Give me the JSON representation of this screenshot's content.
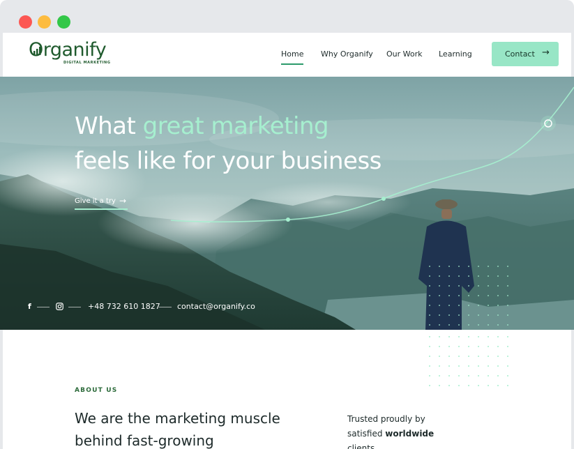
{
  "brand": {
    "name": "Organify",
    "tagline": "DIGITAL MARKETING",
    "color": "#1f5a2d"
  },
  "nav": {
    "items": [
      {
        "label": "Home",
        "active": true
      },
      {
        "label": "Why Organify",
        "active": false
      },
      {
        "label": "Our Work",
        "active": false
      },
      {
        "label": "Learning",
        "active": false
      }
    ],
    "contact_label": "Contact",
    "contact_icon": "arrow-right-icon",
    "contact_color": "#98e6c6"
  },
  "hero": {
    "title_part1": "What ",
    "title_accent": "great marketing",
    "title_line2": "feels like for your business",
    "accent_color": "#a6efcf",
    "cta_label": "Give it a try",
    "cta_icon": "arrow-right-icon",
    "social_icons": [
      "facebook-icon",
      "instagram-icon"
    ],
    "phone": "+48 732 610 1827",
    "email": "contact@organify.co"
  },
  "about": {
    "eyebrow": "ABOUT US",
    "heading": "We are the marketing muscle behind fast-growing",
    "trusted_prefix": "Trusted proudly by satisfied ",
    "trusted_bold": "worldwide",
    "trusted_suffix": " clients"
  }
}
